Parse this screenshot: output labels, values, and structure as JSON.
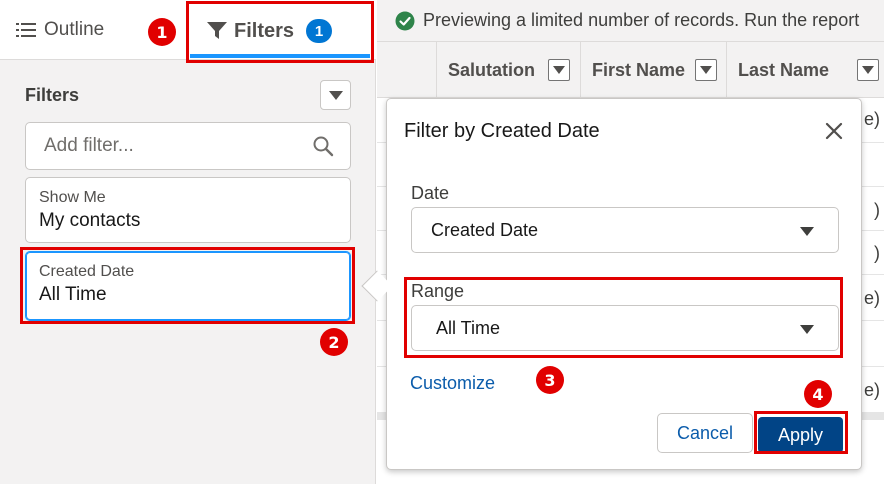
{
  "tabs": {
    "outline_label": "Outline",
    "filters_label": "Filters",
    "filters_count": "1"
  },
  "filters_panel": {
    "title": "Filters",
    "add_filter_placeholder": "Add filter...",
    "cards": [
      {
        "label": "Show Me",
        "value": "My contacts"
      },
      {
        "label": "Created Date",
        "value": "All Time"
      }
    ]
  },
  "report": {
    "banner_text": "Previewing a limited number of records. Run the report",
    "columns": [
      "Salutation",
      "First Name",
      "Last Name"
    ],
    "visible_cell_fragments": [
      "e)",
      ")",
      ")",
      "e)",
      "e)"
    ]
  },
  "popover": {
    "title": "Filter by Created Date",
    "date_label": "Date",
    "date_value": "Created Date",
    "range_label": "Range",
    "range_value": "All Time",
    "customize_label": "Customize",
    "cancel_label": "Cancel",
    "apply_label": "Apply"
  },
  "callouts": [
    "1",
    "2",
    "3",
    "4"
  ],
  "colors": {
    "brand_blue": "#0176d3",
    "apply_blue": "#014486",
    "link_blue": "#0b5cab",
    "callout_red": "#e10000",
    "success_green": "#2e844a"
  },
  "icons": {
    "outline": "list-icon",
    "filters": "funnel-icon",
    "search": "search-icon",
    "banner": "check-circle-icon",
    "close": "close-icon"
  }
}
